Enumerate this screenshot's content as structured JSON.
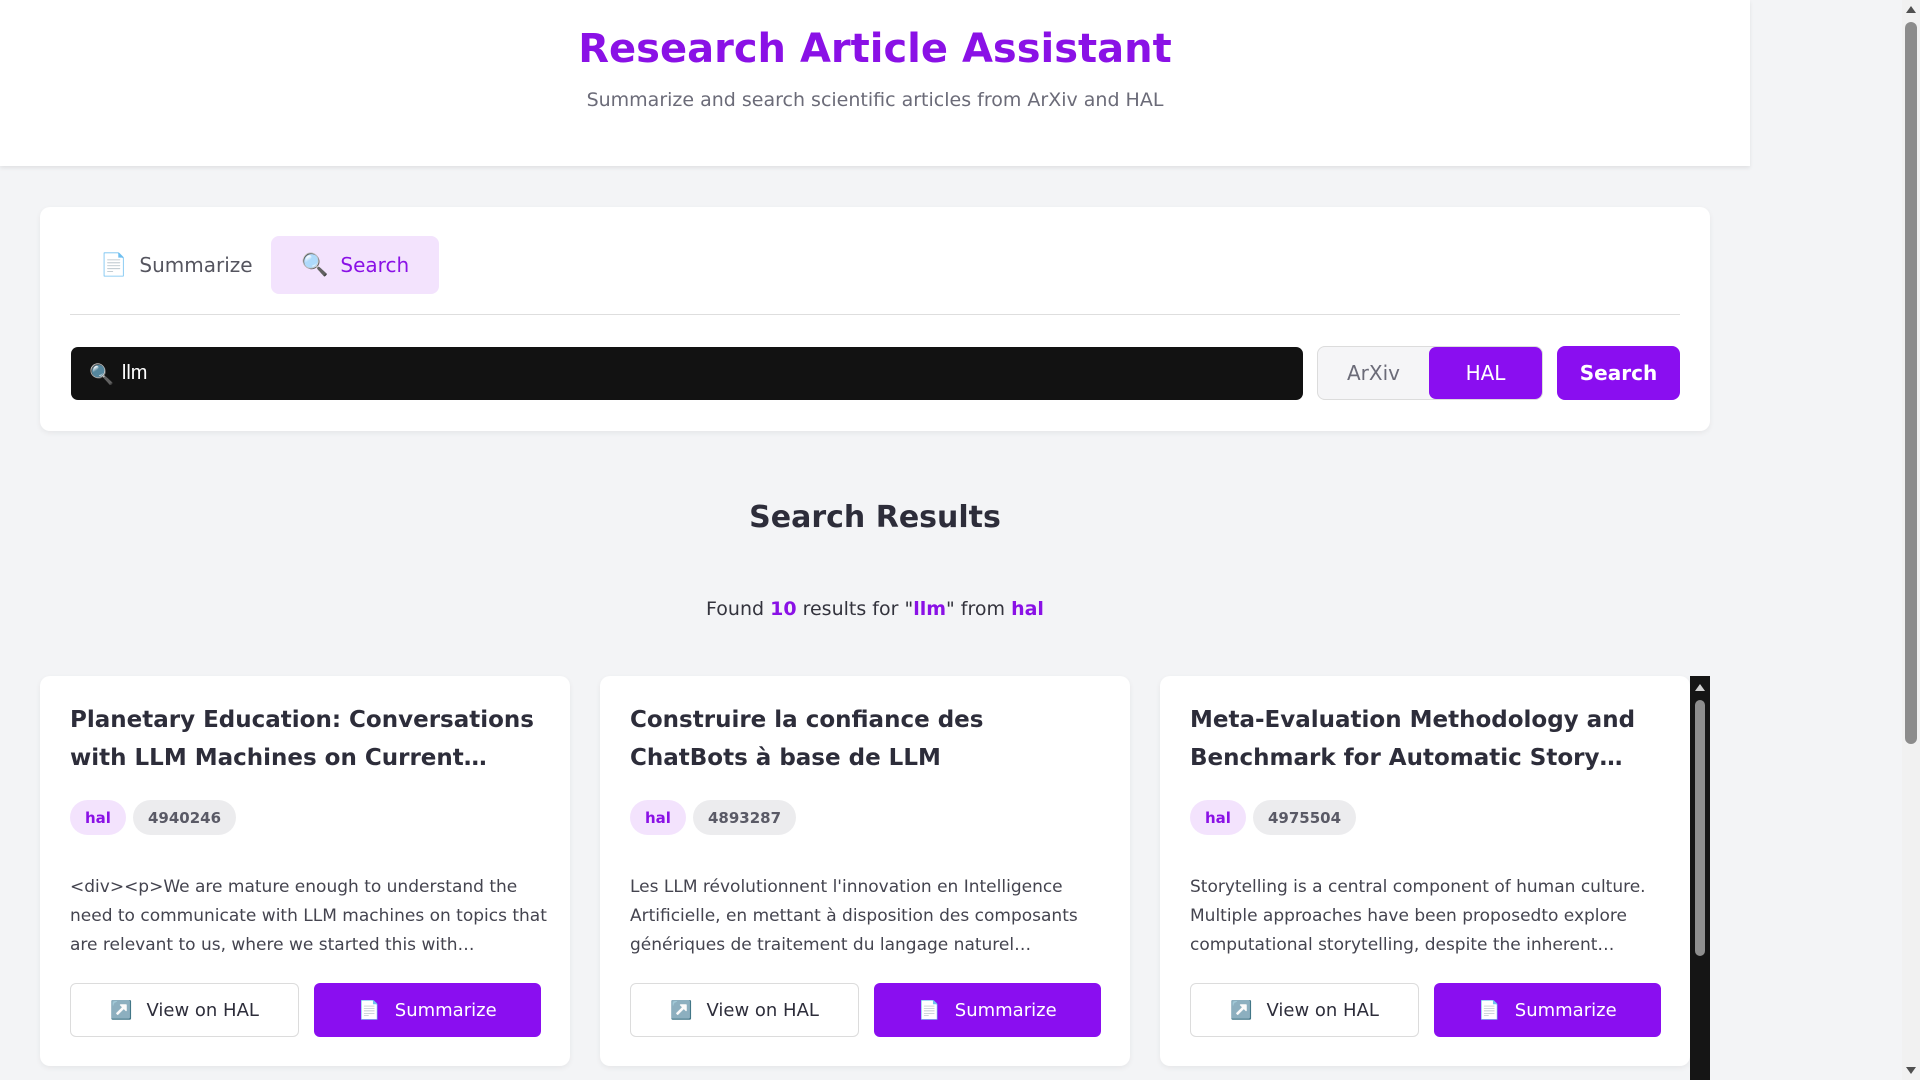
{
  "header": {
    "title": "Research Article Assistant",
    "subtitle": "Summarize and search scientific articles from ArXiv and HAL"
  },
  "tabs": [
    {
      "label": "Summarize",
      "icon": "document-icon",
      "glyph": "📄",
      "active": false
    },
    {
      "label": "Search",
      "icon": "magnifier-icon",
      "glyph": "🔍",
      "active": true
    }
  ],
  "search": {
    "icon_glyph": "🔍",
    "value": "llm",
    "sources": [
      "ArXiv",
      "HAL"
    ],
    "selected_source": "HAL",
    "button_label": "Search"
  },
  "results": {
    "title": "Search Results",
    "summary_prefix": "Found ",
    "count": "10",
    "summary_mid": " results for \"",
    "query": "llm",
    "summary_mid2": "\" from ",
    "source": "hal"
  },
  "cards": [
    {
      "title": "Planetary Education: Conversations with LLM Machines on Current International…",
      "source_tag": "hal",
      "id_tag": "4940246",
      "abstract": "<div><p>We are mature enough to understand the need to communicate with LLM machines on topics that are relevant to us, where we started this with conversations…",
      "view_label": "View on HAL",
      "view_icon": "↗️",
      "summarize_label": "Summarize",
      "summarize_icon": "📄"
    },
    {
      "title": "Construire la confiance des ChatBots à base de LLM",
      "source_tag": "hal",
      "id_tag": "4893287",
      "abstract": "Les LLM révolutionnent l'innovation en Intelligence Artificielle, en mettant à disposition des composants génériques de traitement du langage naturel utilisables…",
      "view_label": "View on HAL",
      "view_icon": "↗️",
      "summarize_label": "Summarize",
      "summarize_icon": "📄"
    },
    {
      "title": "Meta-Evaluation Methodology and Benchmark for Automatic Story…",
      "source_tag": "hal",
      "id_tag": "4975504",
      "abstract": "Storytelling is a central component of human culture. Multiple approaches have been proposedto explore computational storytelling, despite the inherent…",
      "view_label": "View on HAL",
      "view_icon": "↗️",
      "summarize_label": "Summarize",
      "summarize_icon": "📄"
    }
  ],
  "colors": {
    "accent": "#8a0ef0",
    "accent_light": "#f3e3fd",
    "background": "#f3f4f6",
    "search_field_bg": "#121212"
  }
}
